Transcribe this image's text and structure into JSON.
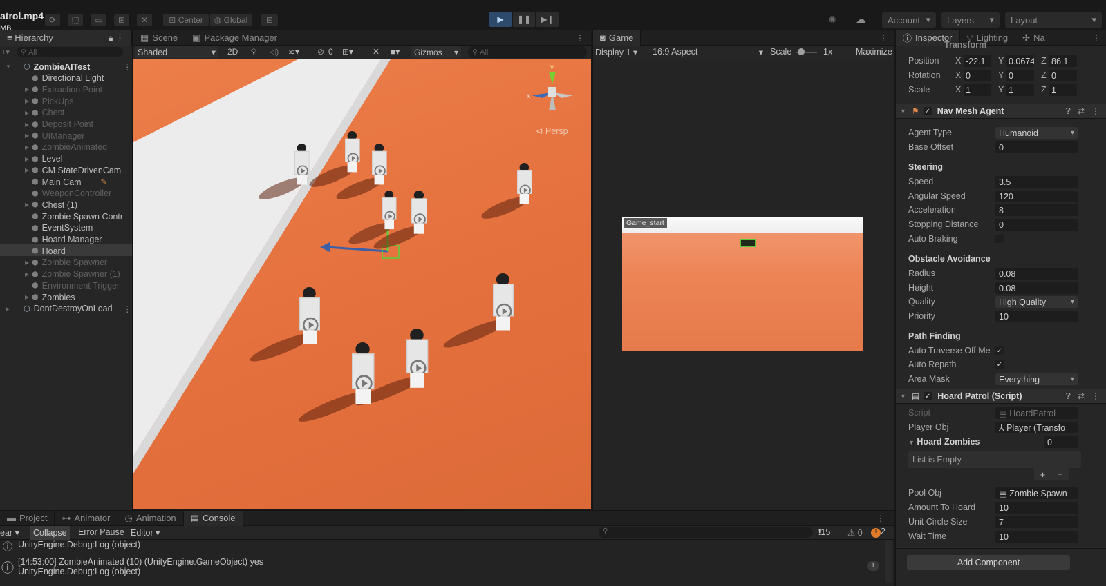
{
  "top": {
    "file_title": "atrol.mp4",
    "file_size": "MB",
    "center_label": "Center",
    "global_label": "Global",
    "account_label": "Account",
    "layers_label": "Layers",
    "layout_label": "Layout"
  },
  "hierarchy": {
    "tab_label": "Hierarchy",
    "search_placeholder": "All",
    "items": [
      {
        "label": "ZombieAITest"
      },
      {
        "label": "Directional Light"
      },
      {
        "label": "Extraction Point"
      },
      {
        "label": "PickUps"
      },
      {
        "label": "Chest"
      },
      {
        "label": "Deposit Point"
      },
      {
        "label": "UIManager"
      },
      {
        "label": "ZombieAnimated"
      },
      {
        "label": "Level"
      },
      {
        "label": "CM StateDrivenCam"
      },
      {
        "label": "Main Cam"
      },
      {
        "label": "WeaponController"
      },
      {
        "label": "Chest (1)"
      },
      {
        "label": "Zombie Spawn Contr"
      },
      {
        "label": "EventSystem"
      },
      {
        "label": "Hoard Manager"
      },
      {
        "label": "Hoard"
      },
      {
        "label": "Zombie Spawner"
      },
      {
        "label": "Zombie Spawner (1)"
      },
      {
        "label": "Environment Trigger"
      },
      {
        "label": "Zombies"
      },
      {
        "label": "DontDestroyOnLoad"
      }
    ]
  },
  "scene": {
    "tab_scene": "Scene",
    "tab_package": "Package Manager",
    "shading": "Shaded",
    "mode_2d": "2D",
    "gizmo_count": "0",
    "gizmos_label": "Gizmos",
    "search_placeholder": "All",
    "gizmo_y": "y",
    "gizmo_x": "x",
    "persp_label": "Persp"
  },
  "game": {
    "tab_label": "Game",
    "display": "Display 1",
    "aspect": "16:9 Aspect",
    "scale_label": "Scale",
    "scale_value": "1x",
    "maximize": "Maximize",
    "overlay_label": "Game_start"
  },
  "inspector": {
    "tab_inspector": "Inspector",
    "tab_lighting": "Lighting",
    "tab_nav": "Na",
    "transform_header": "Transform",
    "position_label": "Position",
    "rotation_label": "Rotation",
    "scale_label": "Scale",
    "axis_x": "X",
    "axis_y": "Y",
    "axis_z": "Z",
    "position": {
      "x": "-22.1",
      "y": "0.0674",
      "z": "86.1"
    },
    "rotation": {
      "x": "0",
      "y": "0",
      "z": "0"
    },
    "scale": {
      "x": "1",
      "y": "1",
      "z": "1"
    },
    "navmesh": {
      "header": "Nav Mesh Agent",
      "agent_type_label": "Agent Type",
      "agent_type": "Humanoid",
      "base_offset_label": "Base Offset",
      "base_offset": "0",
      "steering_label": "Steering",
      "speed_label": "Speed",
      "speed": "3.5",
      "angular_speed_label": "Angular Speed",
      "angular_speed": "120",
      "acceleration_label": "Acceleration",
      "acceleration": "8",
      "stopping_distance_label": "Stopping Distance",
      "stopping_distance": "0",
      "auto_braking_label": "Auto Braking",
      "obstacle_label": "Obstacle Avoidance",
      "radius_label": "Radius",
      "radius": "0.08",
      "height_label": "Height",
      "height": "0.08",
      "quality_label": "Quality",
      "quality": "High Quality",
      "priority_label": "Priority",
      "priority": "10",
      "path_label": "Path Finding",
      "auto_traverse_label": "Auto Traverse Off Me",
      "auto_repath_label": "Auto Repath",
      "area_mask_label": "Area Mask",
      "area_mask": "Everything"
    },
    "hoard": {
      "header": "Hoard Patrol (Script)",
      "script_label": "Script",
      "script": "HoardPatrol",
      "player_label": "Player Obj",
      "player": "Player (Transfo",
      "zombies_label": "Hoard Zombies",
      "zombies_count": "0",
      "list_empty": "List is Empty",
      "pool_label": "Pool Obj",
      "pool": "Zombie Spawn",
      "amount_label": "Amount To Hoard",
      "amount": "10",
      "unit_label": "Unit Circle Size",
      "unit": "7",
      "wait_label": "Wait Time",
      "wait": "10"
    },
    "add_component": "Add Component"
  },
  "console": {
    "tab_project": "Project",
    "tab_animator": "Animator",
    "tab_animation": "Animation",
    "tab_console": "Console",
    "clear_label": "ear",
    "collapse_label": "Collapse",
    "error_pause_label": "Error Pause",
    "editor_label": "Editor",
    "count_info": "15",
    "count_warn": "0",
    "count_error": "2",
    "lines": [
      "UnityEngine.Debug:Log (object)",
      "[14:53:00] ZombieAnimated (10) (UnityEngine.GameObject) yes",
      "UnityEngine.Debug:Log (object)"
    ],
    "line_count": "1"
  }
}
